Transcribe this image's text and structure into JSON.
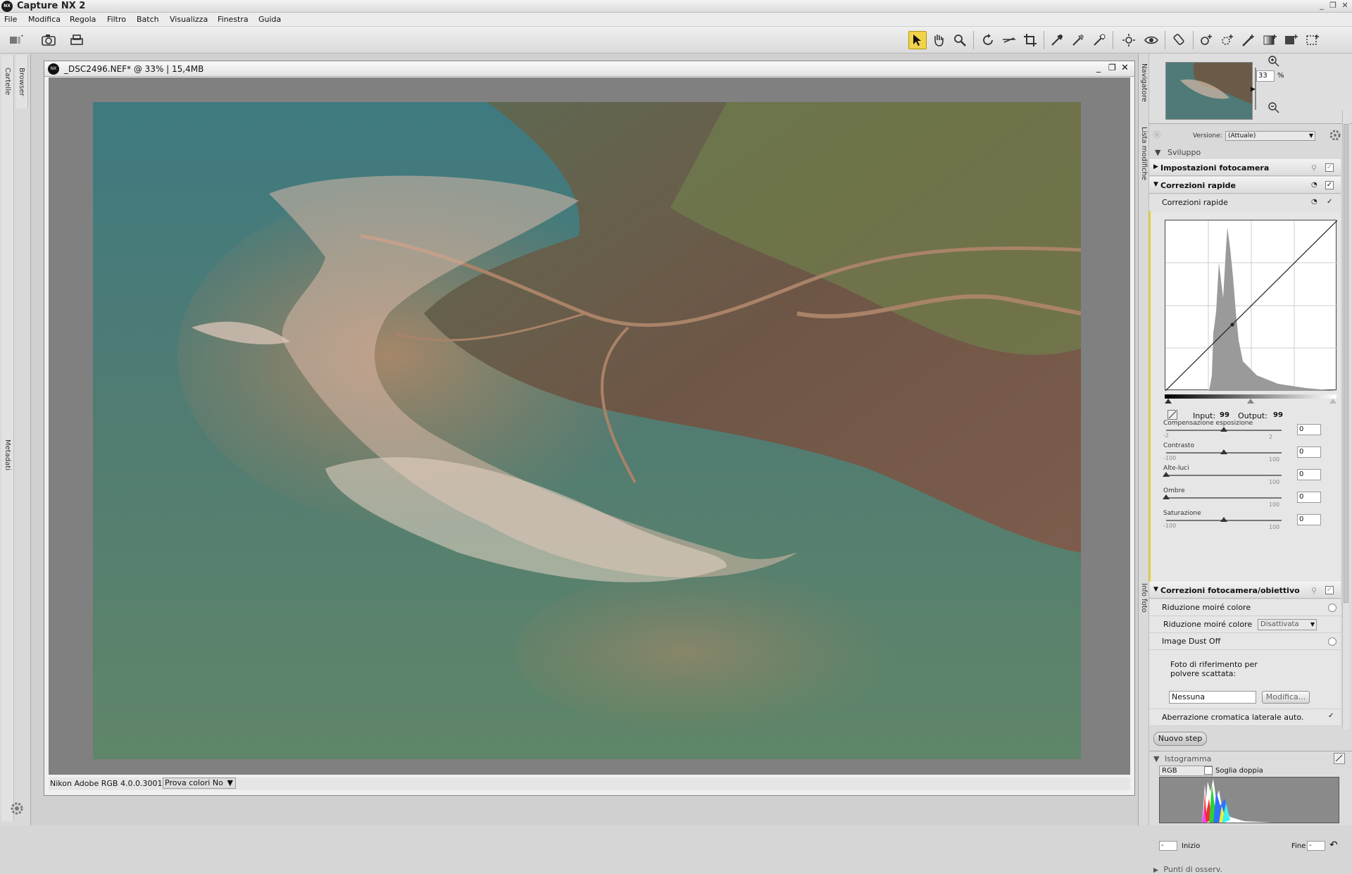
{
  "app": {
    "title": "Capture NX 2",
    "logo_text": "NX"
  },
  "window_controls": {
    "minimize": "_",
    "restore": "❐",
    "close": "✕"
  },
  "menu": [
    "File",
    "Modifica",
    "Regola",
    "Filtro",
    "Batch",
    "Visualizza",
    "Finestra",
    "Guida"
  ],
  "left_tabs": {
    "cartelle": "Cartelle",
    "browser": "Browser",
    "metadati": "Metadati"
  },
  "document": {
    "title": "_DSC2496.NEF* @ 33% | 15,4MB",
    "status_profile": "Nikon Adobe RGB 4.0.0.3001",
    "status_softproof": "Prova colori No"
  },
  "right_tabs": {
    "navigatore": "Navigatore",
    "lista_modifiche": "Lista modifiche",
    "info_foto": "Info foto"
  },
  "navigator": {
    "zoom_value": "33",
    "zoom_unit": "%"
  },
  "edit_list": {
    "version_label": "Versione:",
    "version_value": "(Attuale)",
    "sviluppo": "Sviluppo",
    "impostazioni": "Impostazioni fotocamera",
    "correzioni_rapide": "Correzioni rapide",
    "correzioni_rapide_sub": "Correzioni rapide",
    "input_label": "Input:",
    "input_value": "99",
    "output_label": "Output:",
    "output_value": "99",
    "sliders": [
      {
        "label": "Compensazione esposizione",
        "min": "-2",
        "max": "2",
        "value": "0",
        "pos": 0.5
      },
      {
        "label": "Contrasto",
        "min": "-100",
        "max": "100",
        "value": "0",
        "pos": 0.5
      },
      {
        "label": "Alte-luci",
        "min": "",
        "max": "100",
        "value": "0",
        "pos": 0.0
      },
      {
        "label": "Ombre",
        "min": "",
        "max": "100",
        "value": "0",
        "pos": 0.0
      },
      {
        "label": "Saturazione",
        "min": "-100",
        "max": "100",
        "value": "0",
        "pos": 0.5
      }
    ],
    "camera_lens": "Correzioni fotocamera/obiettivo",
    "moire_row": "Riduzione moiré colore",
    "moire_label": "Riduzione moiré colore",
    "moire_value": "Disattivata",
    "dust_off": "Image Dust Off",
    "dust_ref_label": "Foto di riferimento per polvere scattata:",
    "dust_ref_value": "Nessuna",
    "modifica_btn": "Modifica...",
    "aberrazione": "Aberrazione cromatica laterale auto.",
    "nuovo_step": "Nuovo step"
  },
  "histogram": {
    "title": "Istogramma",
    "channel": "RGB",
    "soglia": "Soglia doppia",
    "inizio_label": "Inizio",
    "inizio_value": "-",
    "fine_label": "Fine",
    "fine_value": "-",
    "punti": "Punti di osserv."
  },
  "colors": {
    "accent_active_tool": "#f2d24a",
    "panel_bg": "#d9d9d9",
    "canvas_bg": "#808080"
  }
}
